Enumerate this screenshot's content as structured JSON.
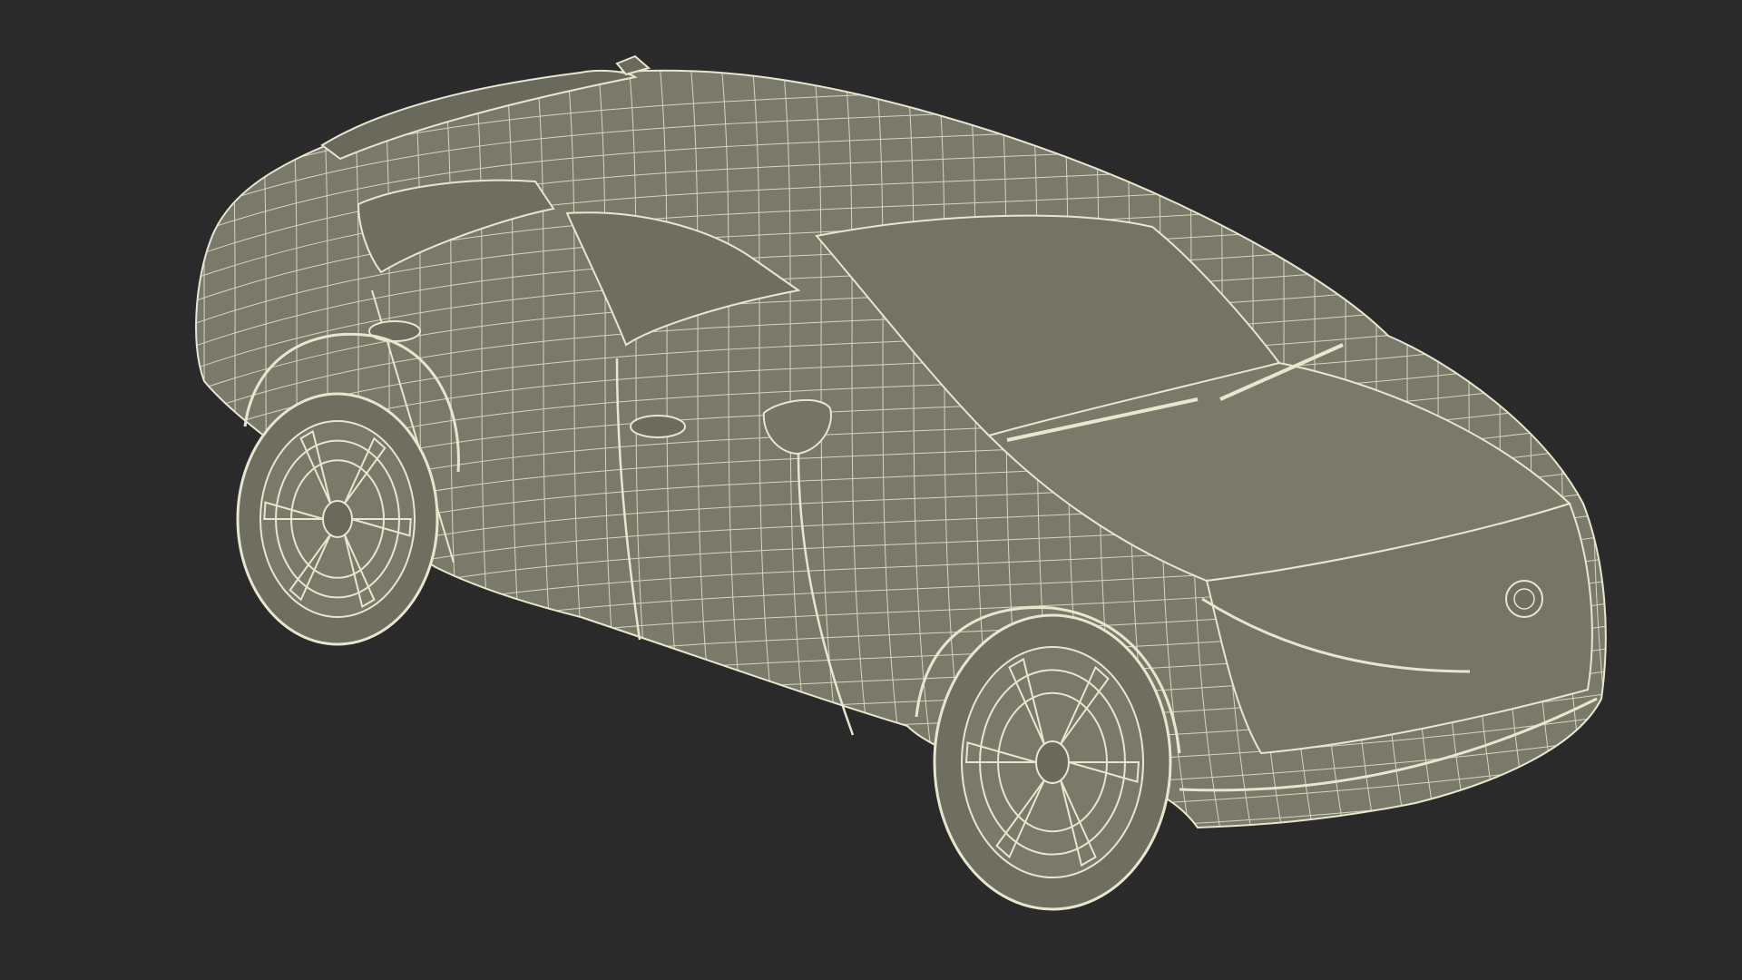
{
  "scene": {
    "subject": "wireframe-car-model",
    "background_color": "#2a2a2a",
    "surface_color": "#7a7a6a",
    "shadow_color": "#5f5f52",
    "wire_color": "#e9e6cf"
  }
}
